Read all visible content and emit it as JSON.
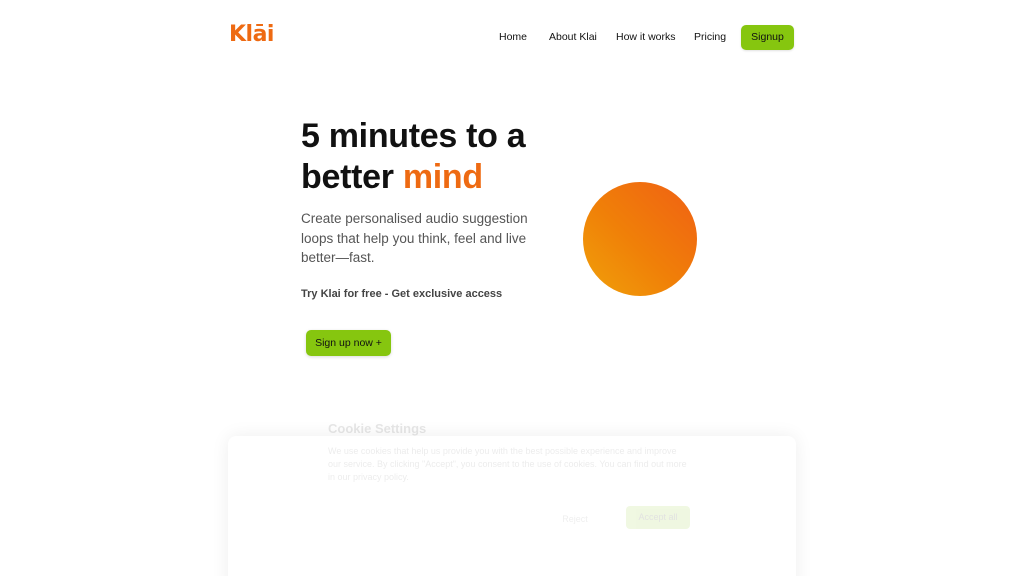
{
  "brand": {
    "name": "Klāi",
    "color": "#ee6a12"
  },
  "nav": {
    "items": [
      {
        "label": "Home"
      },
      {
        "label": "About Klai"
      },
      {
        "label": "How it works"
      },
      {
        "label": "Pricing"
      }
    ],
    "signup_label": "Signup",
    "signup_color": "#86c60f"
  },
  "hero": {
    "title_line1": "5 minutes to a",
    "title_line2_prefix": "better ",
    "title_accent": "mind",
    "description": "Create personalised audio suggestion loops that help you think, feel and live better—fast.",
    "cta_text": "Try Klai for free - Get exclusive access",
    "button_label": "Sign up now +",
    "orb_colors": [
      "#f06014",
      "#f08008",
      "#f0a10a"
    ]
  },
  "cookie": {
    "title": "Cookie Settings",
    "text": "We use cookies that help us provide you with the best possible experience and improve our service. By clicking \"Accept\", you consent to the use of cookies. You can find out more in our privacy policy.",
    "reject_label": "Reject",
    "accept_label": "Accept all"
  }
}
